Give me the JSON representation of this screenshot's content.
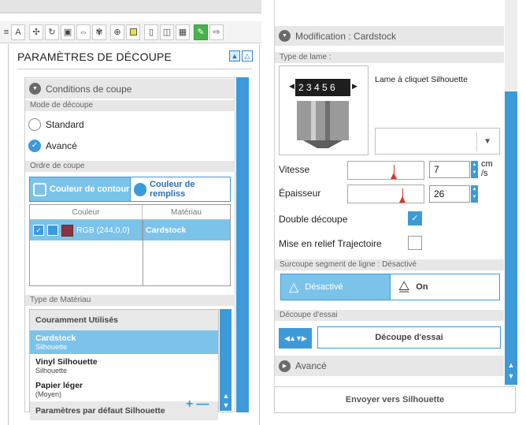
{
  "toolbar": {
    "text_tool_glyph": "A",
    "icons": [
      "text-icon",
      "replicate-icon",
      "rotate-icon",
      "offset-icon",
      "stretch-icon",
      "settings-icon",
      "store-icon",
      "fill-icon",
      "page-icon",
      "registration-icon",
      "grid-icon",
      "cut-settings-icon",
      "send-icon"
    ],
    "accent": "#47b24a"
  },
  "left_panel": {
    "title": "PARAMÈTRES DE DÉCOUPE",
    "conditions_header": "Conditions de coupe",
    "mode_label": "Mode de découpe",
    "mode_options": [
      "Standard",
      "Avancé"
    ],
    "mode_selected": "Avancé",
    "order_label": "Ordre de coupe",
    "order_tabs": [
      "Couleur de contour",
      "Couleur de rempliss"
    ],
    "order_active": "Couleur de contour",
    "table": {
      "columns": [
        "Couleur",
        "Matériau"
      ],
      "rows": [
        {
          "color_text": "RGB (244,0,0)",
          "material": "Cardstock",
          "swatch": "#8b3441"
        }
      ]
    },
    "material_type_label": "Type de Matériau",
    "material_group": "Couramment Utilisés",
    "materials": [
      {
        "name": "Cardstock",
        "sub": "Silhouette",
        "selected": true
      },
      {
        "name": "Vinyl Silhouette",
        "sub": "Silhouette",
        "selected": false
      },
      {
        "name": "Papier léger",
        "sub": "(Moyen)",
        "selected": false
      }
    ],
    "defaults_group": "Paramètres par défaut Silhouette",
    "plus": "+",
    "minus": "—"
  },
  "right_panel": {
    "header": "Modification : Cardstock",
    "blade_type_label": "Type de lame :",
    "blade_name": "Lame à cliquet Silhouette",
    "blade_dial_digits": "2 3 4 5 6",
    "speed_label": "Vitesse",
    "speed_value": "7",
    "speed_unit": "cm /s",
    "speed_fraction": 0.6,
    "thickness_label": "Épaisseur",
    "thickness_value": "26",
    "thickness_fraction": 0.72,
    "double_cut_label": "Double découpe",
    "double_cut_checked": true,
    "emboss_label": "Mise en relief Trajectoire",
    "emboss_checked": false,
    "overcut_label": "Surcoupe segment de ligne : Désactivé",
    "overcut_options": [
      "Désactivé",
      "On"
    ],
    "overcut_selected": "Désactivé",
    "trial_label": "Découpe d'essai",
    "trial_button": "Découpe d'essai",
    "advanced_label": "Avancé",
    "send_button": "Envoyer vers Silhouette"
  },
  "colors": {
    "accent_blue": "#3d9ad8",
    "selected_blue": "#7cc3ea",
    "red_marker": "#d9342b"
  }
}
